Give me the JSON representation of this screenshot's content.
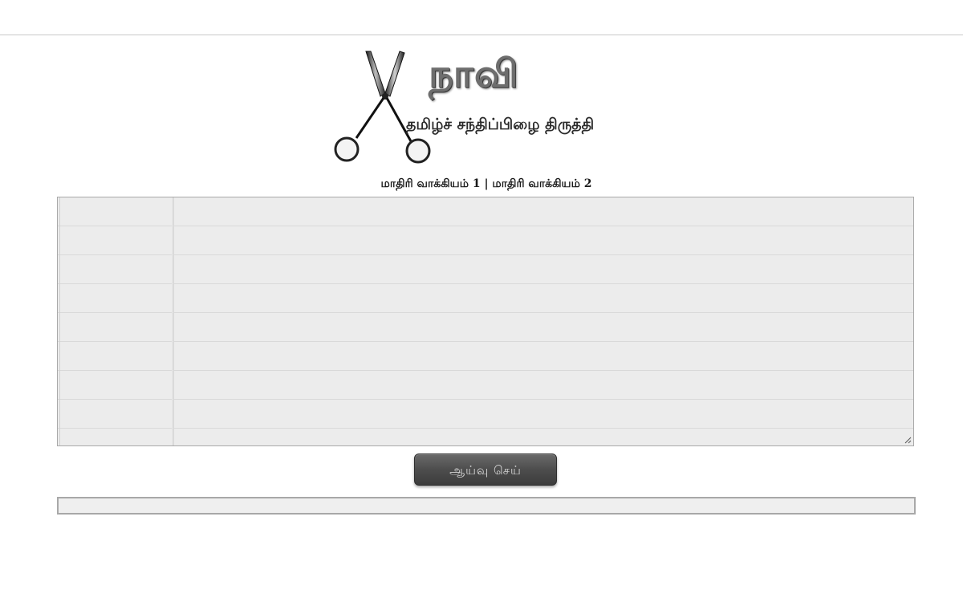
{
  "logo": {
    "title": "நாவி",
    "subtitle": "தமிழ்ச் சந்திப்பிழை திருத்தி",
    "icon": "scissors-icon"
  },
  "samples": {
    "link1": "மாதிரி வாக்கியம் 1",
    "separator": " | ",
    "link2": "மாதிரி வாக்கியம் 2"
  },
  "editor": {
    "value": "",
    "placeholder": ""
  },
  "actions": {
    "check_label": "ஆய்வு செய்"
  },
  "result": {
    "text": ""
  },
  "colors": {
    "button": "#4d4d4d",
    "editor_bg": "#ececec",
    "rule": "#c9c9c9"
  }
}
